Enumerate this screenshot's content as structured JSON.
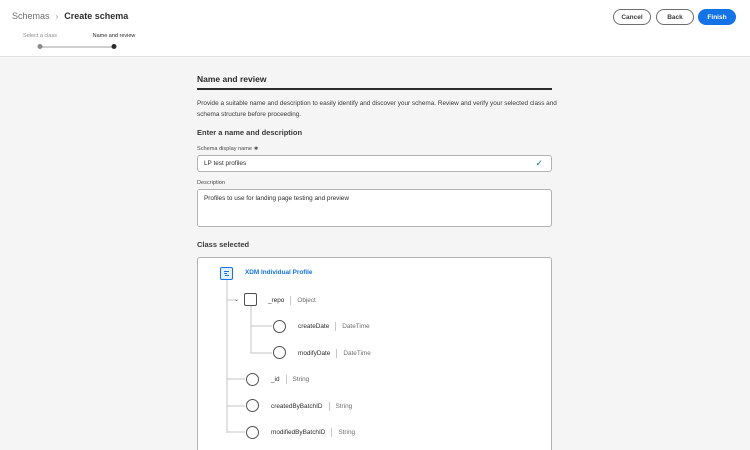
{
  "header": {
    "breadcrumb": {
      "parent": "Schemas",
      "separator": "›",
      "current": "Create schema"
    },
    "steps": [
      {
        "label": "Select a class",
        "state": "complete"
      },
      {
        "label": "Name and review",
        "state": "current"
      }
    ],
    "buttons": {
      "cancel": "Cancel",
      "back": "Back",
      "finish": "Finish"
    }
  },
  "main": {
    "title": "Name and review",
    "intro": "Provide a suitable name and description to easily identify and discover your schema. Review and verify your selected class and schema structure before proceeding.",
    "name_section": {
      "heading": "Enter a name and description",
      "display_name_label": "Schema display name",
      "required_marker": "✱",
      "display_name_value": "LP test profiles",
      "valid_icon": "checkmark-icon",
      "description_label": "Description",
      "description_value": "Profiles to use for landing page testing and preview"
    },
    "class_section": {
      "heading": "Class selected",
      "root": {
        "name": "XDM Individual Profile",
        "icon": "class-icon"
      },
      "fields": [
        {
          "name": "_repo",
          "type": "Object",
          "icon": "object-icon",
          "expanded": true
        },
        {
          "name": "createDate",
          "type": "DateTime",
          "icon": "field-icon"
        },
        {
          "name": "modifyDate",
          "type": "DateTime",
          "icon": "field-icon"
        },
        {
          "name": "_id",
          "type": "String",
          "icon": "field-icon"
        },
        {
          "name": "createdByBatchID",
          "type": "String",
          "icon": "field-icon"
        },
        {
          "name": "modifiedByBatchID",
          "type": "String",
          "icon": "field-icon"
        }
      ]
    }
  },
  "colors": {
    "accent": "#1473e6",
    "valid": "#12805c",
    "page_bg": "#f5f5f5"
  }
}
